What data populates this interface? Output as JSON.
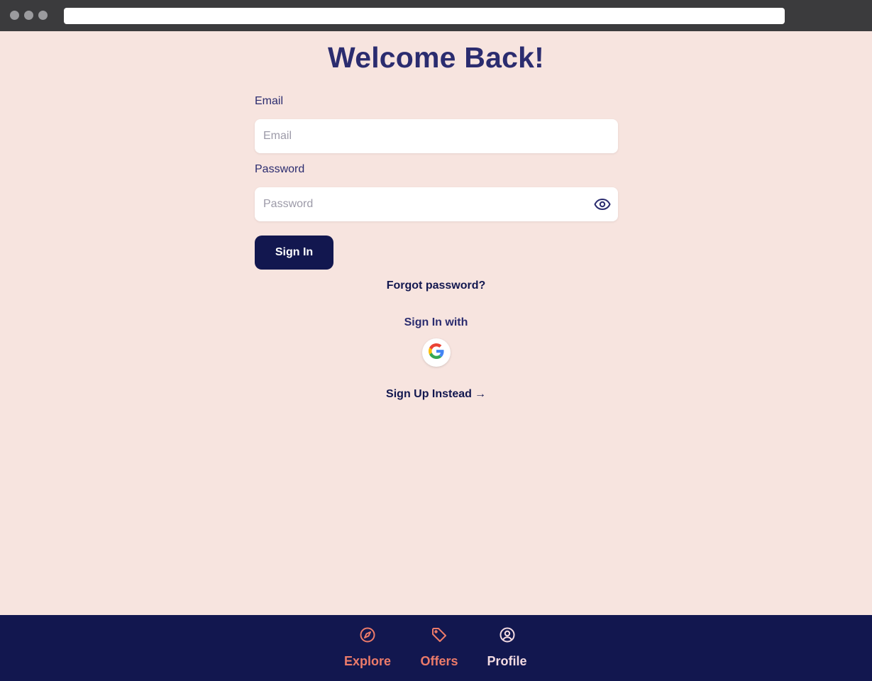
{
  "page": {
    "title": "Welcome Back!"
  },
  "form": {
    "email_label": "Email",
    "email_placeholder": "Email",
    "email_value": "",
    "password_label": "Password",
    "password_placeholder": "Password",
    "password_value": "",
    "signin_button": "Sign In",
    "forgot_password": "Forgot password?",
    "signin_with": "Sign In with",
    "signup_link": "Sign Up Instead",
    "signup_arrow": "→"
  },
  "icons": {
    "password_toggle": "eye-icon",
    "social": "google-icon",
    "explore": "compass-icon",
    "offers": "tag-icon",
    "profile": "user-circle-icon"
  },
  "nav": {
    "items": [
      {
        "label": "Explore",
        "active": false
      },
      {
        "label": "Offers",
        "active": false
      },
      {
        "label": "Profile",
        "active": true
      }
    ]
  },
  "colors": {
    "background": "#f7e4df",
    "primary": "#12174f",
    "heading": "#2b2c6f",
    "nav_accent": "#ec7b6a",
    "nav_active": "#f3dbe2"
  }
}
